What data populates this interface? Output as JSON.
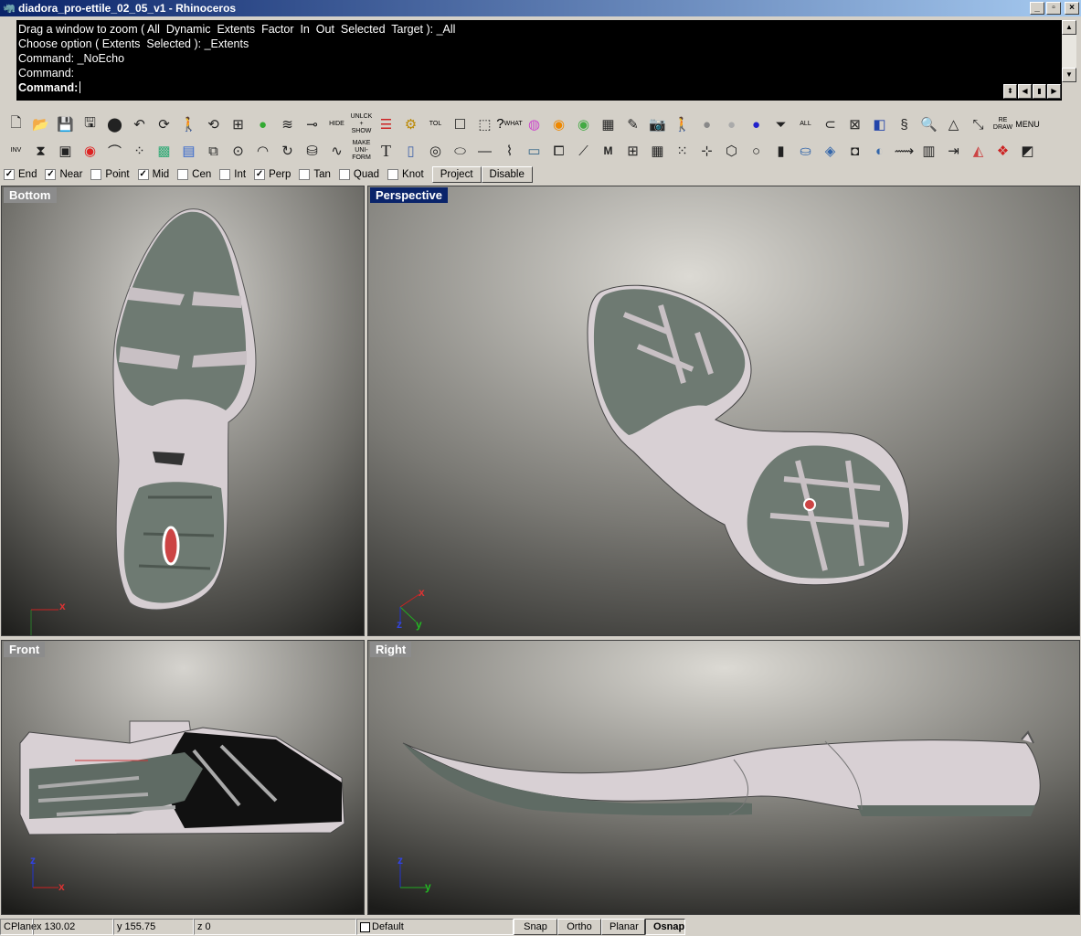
{
  "window": {
    "title": "diadora_pro-ettile_02_05_v1 - Rhinoceros",
    "minimize": "_",
    "maximize": "▫",
    "close": "×"
  },
  "command": {
    "lines": [
      "Drag a window to zoom ( All  Dynamic  Extents  Factor  In  Out  Selected  Target ): _All",
      "Choose option ( Extents  Selected ): _Extents",
      "Command: _NoEcho",
      "Command:"
    ],
    "prompt": "Command:"
  },
  "toolbars": {
    "row1_text": {
      "hide": "HIDE",
      "unlock_show": "UNLCK + SHOW",
      "tol": "TOL",
      "what": "WHAT",
      "all": "ALL",
      "redraw": "RE DRAW",
      "menu": "MENU"
    },
    "row2_text": {
      "inv": "INV",
      "make_uniform": "MAKE UNI- FORM"
    }
  },
  "osnap": {
    "items": [
      {
        "label": "End",
        "checked": true
      },
      {
        "label": "Near",
        "checked": true
      },
      {
        "label": "Point",
        "checked": false
      },
      {
        "label": "Mid",
        "checked": true
      },
      {
        "label": "Cen",
        "checked": false
      },
      {
        "label": "Int",
        "checked": false
      },
      {
        "label": "Perp",
        "checked": true
      },
      {
        "label": "Tan",
        "checked": false
      },
      {
        "label": "Quad",
        "checked": false
      },
      {
        "label": "Knot",
        "checked": false
      }
    ],
    "project": "Project",
    "disable": "Disable"
  },
  "viewports": {
    "bottom": {
      "title": "Bottom",
      "axis_x": "x"
    },
    "perspective": {
      "title": "Perspective",
      "axis_x": "x",
      "axis_y": "y",
      "axis_z": "z"
    },
    "front": {
      "title": "Front",
      "axis_x": "x",
      "axis_z": "z"
    },
    "right": {
      "title": "Right",
      "axis_y": "y",
      "axis_z": "z"
    }
  },
  "status": {
    "cplane": "CPlane",
    "x": "x 130.02",
    "y": "y 155.75",
    "z": "z 0",
    "layer": "Default",
    "snap": "Snap",
    "ortho": "Ortho",
    "planar": "Planar",
    "osnap": "Osnap"
  },
  "colors": {
    "titlebar": "#0a246a",
    "sole_rubber": "#6e7a72",
    "sole_midsole": "#d8d0d4",
    "axis_x": "#cc2222",
    "axis_y": "#22aa22",
    "axis_z": "#2233cc"
  }
}
